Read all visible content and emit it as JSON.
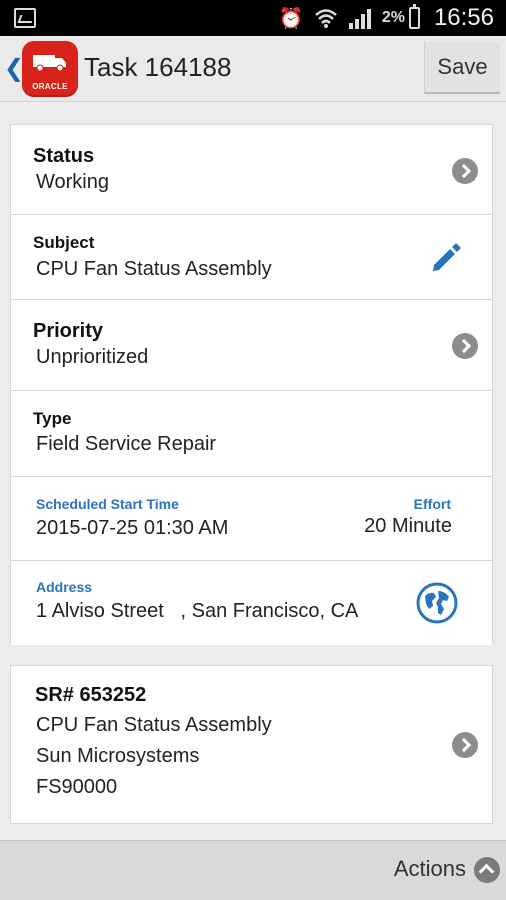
{
  "status_bar": {
    "battery_percent": "2%",
    "time": "16:56",
    "icons": [
      "image-icon",
      "alarm-icon",
      "wifi-icon",
      "signal-icon",
      "battery-icon"
    ]
  },
  "header": {
    "back_icon": "chevron-left-icon",
    "logo_text": "ORACLE",
    "title": "Task 164188",
    "save_label": "Save"
  },
  "task": {
    "status": {
      "label": "Status",
      "value": "Working"
    },
    "subject": {
      "label": "Subject",
      "value": "CPU Fan Status Assembly"
    },
    "priority": {
      "label": "Priority",
      "value": "Unprioritized"
    },
    "type": {
      "label": "Type",
      "value": "Field Service Repair"
    },
    "schedule": {
      "start_label": "Scheduled Start Time",
      "start_value": "2015-07-25 01:30 AM",
      "effort_label": "Effort",
      "effort_value": "20 Minute"
    },
    "address": {
      "label": "Address",
      "value": "1 Alviso Street   , San Francisco, CA"
    }
  },
  "service_request": {
    "number": "SR# 653252",
    "subject": "CPU Fan Status Assembly",
    "company": "Sun Microsystems",
    "code": "FS90000"
  },
  "footer": {
    "actions_label": "Actions"
  },
  "colors": {
    "accent_blue": "#2a73bd",
    "oracle_red": "#d8231a",
    "chevron_gray": "#8d8d8d"
  }
}
